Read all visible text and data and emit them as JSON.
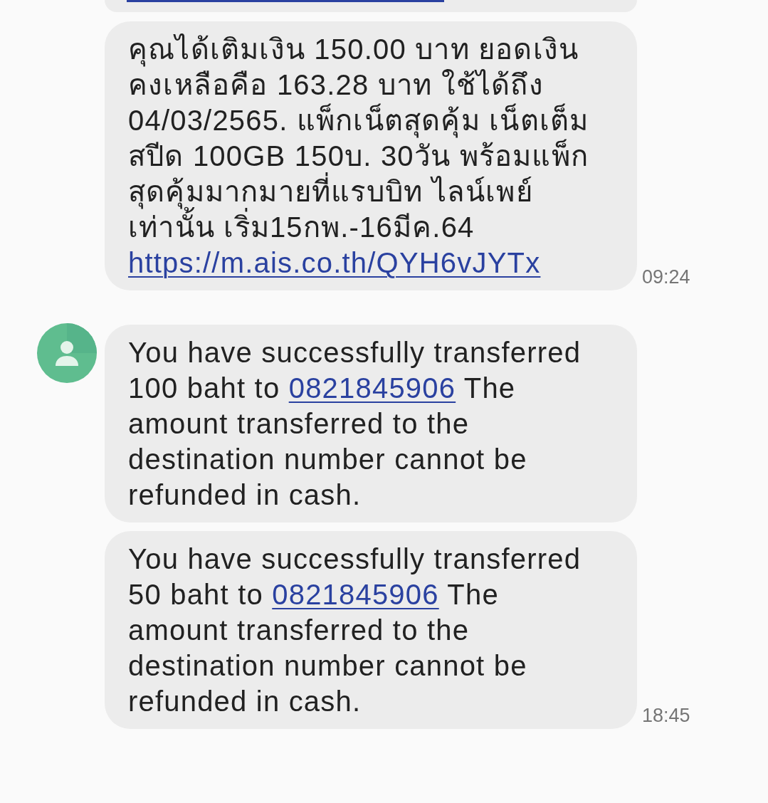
{
  "messages": [
    {
      "kind": "cut_off"
    },
    {
      "kind": "text",
      "avatar": false,
      "segments": [
        {
          "text": "คุณได้เติมเงิน 150.00 บาท ยอดเงินคงเหลือคือ 163.28 บาท ใช้ได้ถึง 04/03/2565. แพ็กเน็ตสุดคุ้ม เน็ตเต็มสปีด 100GB 150บ. 30วัน พร้อมแพ็กสุดคุ้มมากมายที่แรบบิท ไลน์เพย์เท่านั้น เริ่ม15กพ.-16มีค.64 ",
          "link": false
        },
        {
          "text": "https://m.ais.co.th/QYH6vJYTx",
          "link": true
        }
      ],
      "time": "09:24"
    },
    {
      "kind": "text",
      "avatar": true,
      "segments": [
        {
          "text": "You have successfully transferred 100 baht to ",
          "link": false
        },
        {
          "text": "0821845906",
          "link": true
        },
        {
          "text": " The amount transferred to the destination number cannot be refunded in cash.",
          "link": false
        }
      ]
    },
    {
      "kind": "text",
      "avatar": false,
      "segments": [
        {
          "text": "You have successfully transferred 50 baht to ",
          "link": false
        },
        {
          "text": "0821845906",
          "link": true
        },
        {
          "text": " The amount transferred to the destination number cannot be refunded in cash.",
          "link": false
        }
      ],
      "time": "18:45"
    }
  ]
}
